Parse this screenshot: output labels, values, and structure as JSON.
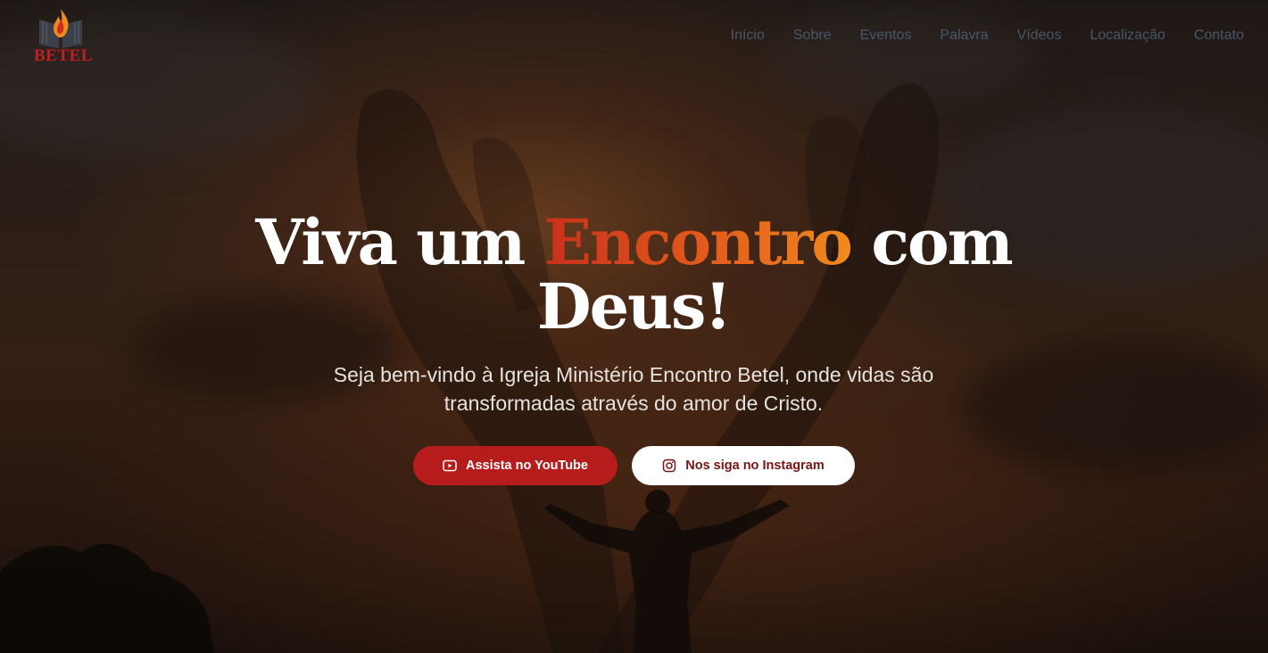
{
  "logo": {
    "text": "BETEL",
    "icon": "flame-book-logo"
  },
  "nav": {
    "items": [
      "Início",
      "Sobre",
      "Eventos",
      "Palavra",
      "Vídeos",
      "Localização",
      "Contato"
    ]
  },
  "hero": {
    "headline_part1": "Viva um ",
    "headline_accent": "Encontro",
    "headline_part2": " com",
    "headline_line2": "Deus!",
    "subtitle": "Seja bem-vindo à Igreja Ministério Encontro Betel, onde vidas são transformadas através do amor de Cristo.",
    "youtube_button": {
      "label": "Assista no YouTube",
      "icon": "youtube-icon"
    },
    "instagram_button": {
      "label": "Nos siga no Instagram",
      "icon": "instagram-icon"
    }
  },
  "colors": {
    "brand_red": "#b71c1c",
    "accent_orange": "#e35d1c",
    "nav_text": "#4a5668"
  }
}
